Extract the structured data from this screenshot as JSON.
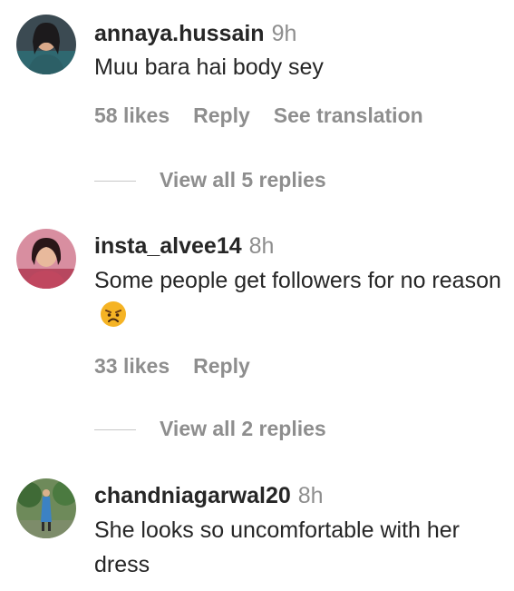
{
  "comments": [
    {
      "username": "annaya.hussain",
      "time": "9h",
      "text": "Muu bara hai body sey",
      "likes": "58 likes",
      "reply": "Reply",
      "translate": "See translation",
      "view_replies": "View all 5 replies"
    },
    {
      "username": "insta_alvee14",
      "time": "8h",
      "text": "Some people get followers for no reason",
      "emoji": "angry-face-emoji",
      "likes": "33 likes",
      "reply": "Reply",
      "view_replies": "View all 2 replies"
    },
    {
      "username": "chandniagarwal20",
      "time": "8h",
      "text": "She looks so uncomfortable with her dress"
    }
  ],
  "colors": {
    "primary_text": "#262626",
    "secondary_text": "#8e8e8e",
    "divider": "#c7c7c7",
    "emoji": "#f5b324"
  }
}
